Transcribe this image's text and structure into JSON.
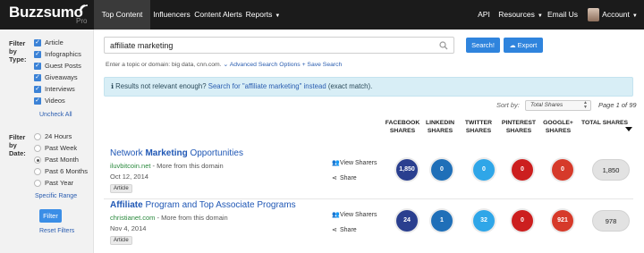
{
  "app": {
    "logo": "Buzzsumo",
    "logo_sub": "Pro"
  },
  "nav": {
    "items": [
      "Top Content",
      "Influencers",
      "Content Alerts",
      "Reports"
    ],
    "right": [
      "API",
      "Resources",
      "Email Us",
      "Account"
    ]
  },
  "sidebar": {
    "type_label": "Filter by Type:",
    "types": [
      "Article",
      "Infographics",
      "Guest Posts",
      "Giveaways",
      "Interviews",
      "Videos"
    ],
    "uncheck_all": "Uncheck All",
    "date_label": "Filter by Date:",
    "dates": [
      "24 Hours",
      "Past Week",
      "Past Month",
      "Past 6 Months",
      "Past Year"
    ],
    "selected_date": "Past Month",
    "specific_range": "Specific Range",
    "filter_button": "Filter",
    "reset_filters": "Reset Filters"
  },
  "search": {
    "value": "affiliate marketing",
    "search_button": "Search!",
    "export_button": "Export",
    "hint_prefix": "Enter a topic or domain: big data, cnn.com.",
    "advanced_link": "Advanced Search Options",
    "save_link": "+ Save Search"
  },
  "notice": {
    "prefix": "Results not relevant enough?",
    "link": "Search for \"affiliate marketing\" instead",
    "suffix": "(exact match)."
  },
  "sort": {
    "label": "Sort by:",
    "selected": "Total Shares",
    "page_info": "Page 1 of 99"
  },
  "columns": [
    "FACEBOOK SHARES",
    "LINKEDIN SHARES",
    "TWITTER SHARES",
    "PINTEREST SHARES",
    "GOOGLE+ SHARES",
    "TOTAL SHARES"
  ],
  "results": [
    {
      "title_pre": "Network ",
      "title_bold": "Marketing",
      "title_post": " Opportunities",
      "domain": "iluvbitcoin.net",
      "domain_suffix": " - More from this domain",
      "date": "Oct 12, 2014",
      "tag": "Article",
      "view_sharers": "View Sharers",
      "share": "Share",
      "facebook": "1,850",
      "linkedin": "0",
      "twitter": "0",
      "pinterest": "0",
      "googleplus": "0",
      "total": "1,850"
    },
    {
      "title_pre": "",
      "title_bold": "Affiliate",
      "title_post": " Program and Top Associate Programs",
      "domain": "christianet.com",
      "domain_suffix": " - More from this domain",
      "date": "Nov 4, 2014",
      "tag": "Article",
      "view_sharers": "View Sharers",
      "share": "Share",
      "facebook": "24",
      "linkedin": "1",
      "twitter": "32",
      "pinterest": "0",
      "googleplus": "921",
      "total": "978"
    }
  ],
  "colors": {
    "facebook": "#2a3f8f",
    "linkedin": "#1f6fb8",
    "twitter": "#2fa6e8",
    "pinterest": "#cc1f1f",
    "googleplus": "#d63a2a",
    "accent": "#2f84dd"
  }
}
